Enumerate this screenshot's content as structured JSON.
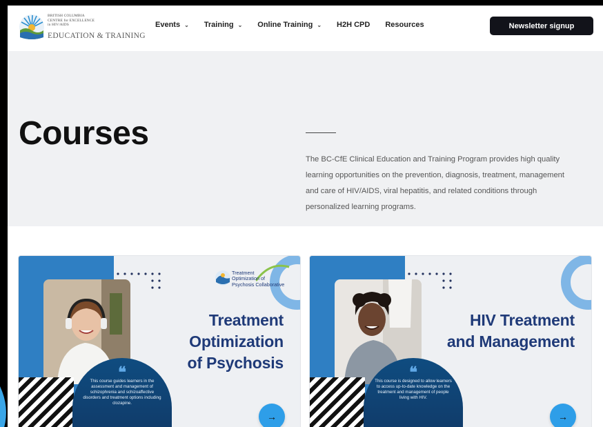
{
  "header": {
    "logo": {
      "small_lines": [
        "BRITISH COLUMBIA",
        "CENTRE for EXCELLENCE",
        "in HIV/AIDS"
      ],
      "big": "EDUCATION & TRAINING"
    },
    "nav": [
      {
        "label": "Events",
        "has_dropdown": true
      },
      {
        "label": "Training",
        "has_dropdown": true
      },
      {
        "label": "Online Training",
        "has_dropdown": true
      },
      {
        "label": "H2H CPD",
        "has_dropdown": false
      },
      {
        "label": "Resources",
        "has_dropdown": false
      }
    ],
    "signup_label": "Newsletter signup"
  },
  "hero": {
    "title": "Courses",
    "description": "The BC-CfE Clinical Education and Training Program provides high quality learning opportunities on the prevention, diagnosis, treatment, management and care of HIV/AIDS, viral hepatitis, and related conditions through personalized learning programs."
  },
  "cards": [
    {
      "title_lines": [
        "Treatment",
        "Optimization",
        "of Psychosis"
      ],
      "partner_logo_lines": [
        "Treatment",
        "Optimization of",
        "Psychosis Collaborative"
      ],
      "quote": "This course guides learners in the assessment and management of schizophrenia and schizoaffective disorders and treatment options including clozapine.",
      "arrow": "→"
    },
    {
      "title_lines": [
        "HIV Treatment",
        "and Management"
      ],
      "quote": "This course is designed to allow learners to access up-to-date knowledge on the treatment and management of people living with HIV.",
      "arrow": "→"
    }
  ],
  "colors": {
    "nav_button_bg": "#12131a",
    "hero_bg": "#f0f1f3",
    "card_blue": "#2f7fc3",
    "title_navy": "#1f3a78",
    "arrow_blue": "#2e9ee8"
  },
  "icons": {
    "nav_dropdown": "chevron-down-icon",
    "card_link": "arrow-right-icon"
  }
}
